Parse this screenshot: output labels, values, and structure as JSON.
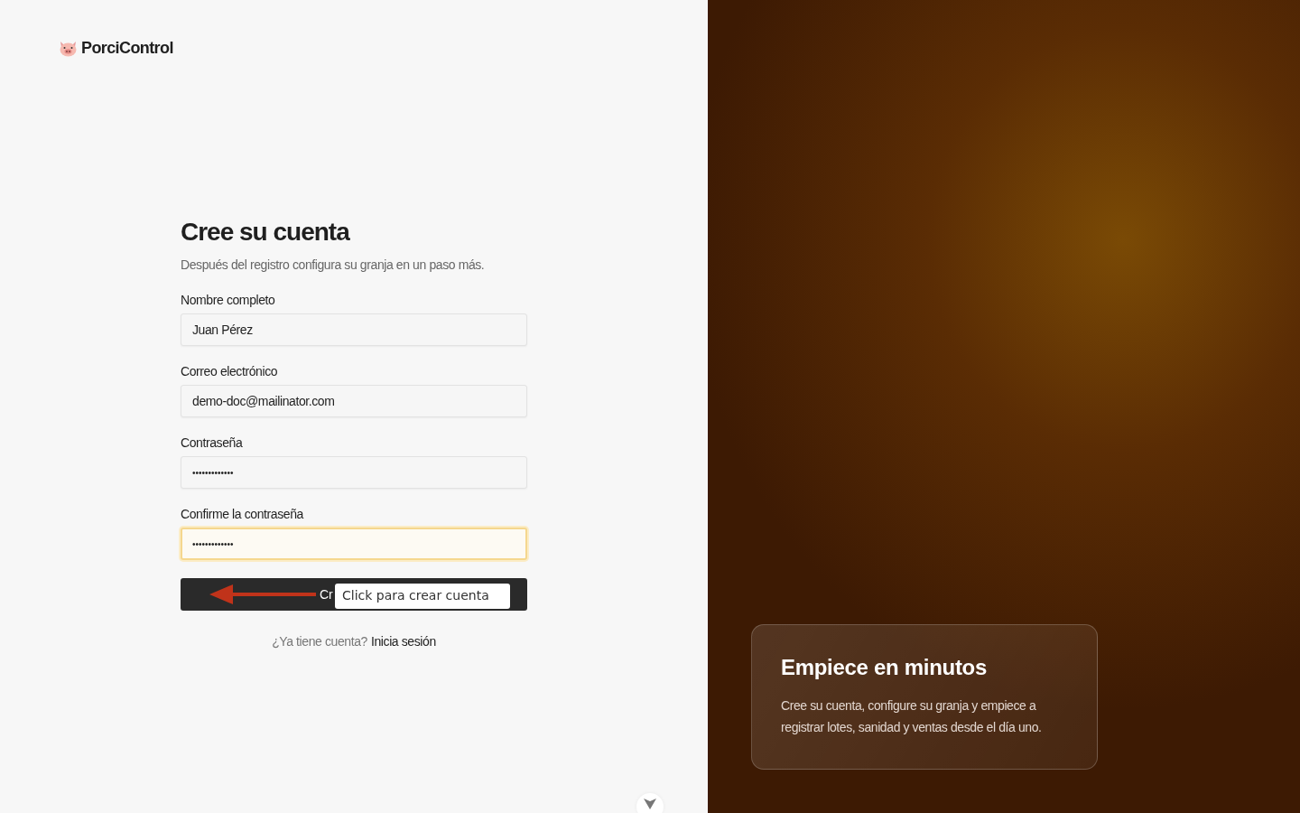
{
  "brand": {
    "name": "PorciControl"
  },
  "form": {
    "title": "Cree su cuenta",
    "subtitle": "Después del registro configura su granja en un paso más.",
    "fields": [
      {
        "label": "Nombre completo",
        "kind": "text",
        "value": "Juan Pérez",
        "focused": false
      },
      {
        "label": "Correo electrónico",
        "kind": "text",
        "value": "demo-doc@mailinator.com",
        "focused": false
      },
      {
        "label": "Contraseña",
        "kind": "password",
        "value": "•••••••••••••",
        "focused": false
      },
      {
        "label": "Confirme la contraseña",
        "kind": "password",
        "value": "•••••••••••••",
        "focused": true
      }
    ],
    "submit": {
      "label": "Cr"
    },
    "tooltip": {
      "text": "Click para crear cuenta"
    },
    "footer": {
      "prompt": "¿Ya tiene cuenta?",
      "link": "Inicia sesión"
    }
  },
  "hero": {
    "title": "Empiece en minutos",
    "text": "Cree su cuenta, configure su granja y empiece a registrar lotes, sanidad y ventas desde el día uno."
  }
}
